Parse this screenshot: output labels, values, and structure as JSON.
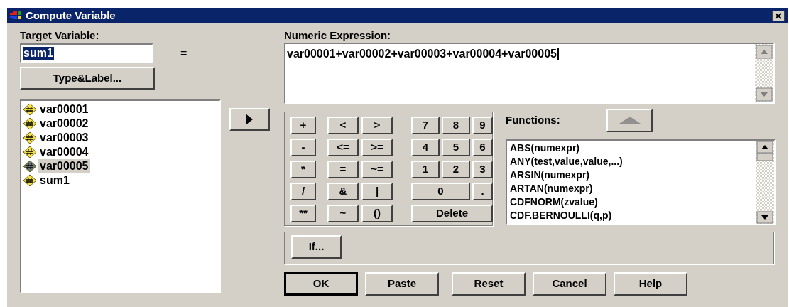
{
  "window": {
    "title": "Compute Variable"
  },
  "target_variable": {
    "label": "Target Variable:",
    "value": "sum1",
    "value_selected": true
  },
  "equals_sign": "=",
  "type_label_button": {
    "label": "Type&Label..."
  },
  "variables": [
    {
      "name": "var00001",
      "selected": false
    },
    {
      "name": "var00002",
      "selected": false
    },
    {
      "name": "var00003",
      "selected": false
    },
    {
      "name": "var00004",
      "selected": false
    },
    {
      "name": "var00005",
      "selected": true
    },
    {
      "name": "sum1",
      "selected": false
    }
  ],
  "numeric_expression": {
    "label": "Numeric Expression:",
    "value": "var00001+var00002+var00003+var00004+var00005"
  },
  "keypad": {
    "operators": [
      "+",
      "-",
      "*",
      "/",
      "**"
    ],
    "relations": [
      "<",
      ">",
      "<=",
      ">=",
      "=",
      "~=",
      "&",
      "|",
      "~",
      "()"
    ],
    "digits": [
      {
        "label": "7",
        "kind": "single"
      },
      {
        "label": "8",
        "kind": "single"
      },
      {
        "label": "9",
        "kind": "single"
      },
      {
        "label": "4",
        "kind": "single"
      },
      {
        "label": "5",
        "kind": "single"
      },
      {
        "label": "6",
        "kind": "single"
      },
      {
        "label": "1",
        "kind": "single"
      },
      {
        "label": "2",
        "kind": "single"
      },
      {
        "label": "3",
        "kind": "single"
      },
      {
        "label": "0",
        "kind": "double"
      },
      {
        "label": ".",
        "kind": "single"
      },
      {
        "label": "Delete",
        "kind": "triple"
      }
    ]
  },
  "functions": {
    "label": "Functions:",
    "items": [
      "ABS(numexpr)",
      "ANY(test,value,value,...)",
      "ARSIN(numexpr)",
      "ARTAN(numexpr)",
      "CDFNORM(zvalue)",
      "CDF.BERNOULLI(q,p)"
    ]
  },
  "if_button": {
    "label": "If..."
  },
  "buttons": [
    {
      "label": "OK",
      "default": true
    },
    {
      "label": "Paste",
      "default": false
    },
    {
      "label": "Reset",
      "default": false
    },
    {
      "label": "Cancel",
      "default": false
    },
    {
      "label": "Help",
      "default": false
    }
  ]
}
